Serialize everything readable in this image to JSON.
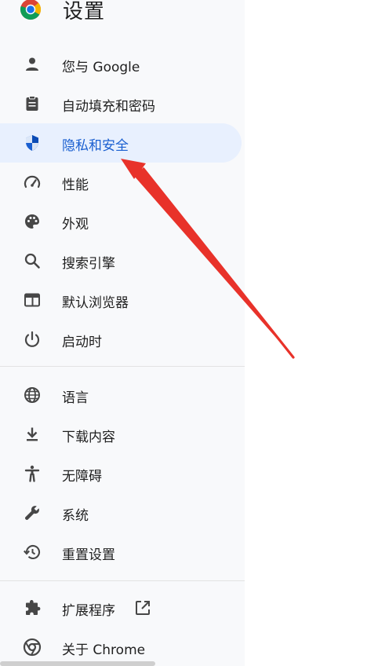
{
  "header": {
    "title": "设置"
  },
  "nav": {
    "items": [
      {
        "label": "您与 Google",
        "icon": "person-icon"
      },
      {
        "label": "自动填充和密码",
        "icon": "clipboard-icon"
      },
      {
        "label": "隐私和安全",
        "icon": "shield-icon",
        "active": true
      },
      {
        "label": "性能",
        "icon": "speedometer-icon"
      },
      {
        "label": "外观",
        "icon": "palette-icon"
      },
      {
        "label": "搜索引擎",
        "icon": "search-icon"
      },
      {
        "label": "默认浏览器",
        "icon": "browser-window-icon"
      },
      {
        "label": "启动时",
        "icon": "power-icon"
      },
      {
        "label": "语言",
        "icon": "globe-icon"
      },
      {
        "label": "下载内容",
        "icon": "download-icon"
      },
      {
        "label": "无障碍",
        "icon": "accessibility-icon"
      },
      {
        "label": "系统",
        "icon": "wrench-icon"
      },
      {
        "label": "重置设置",
        "icon": "history-icon"
      },
      {
        "label": "扩展程序",
        "icon": "puzzle-icon"
      },
      {
        "label": "关于 Chrome",
        "icon": "chrome-icon"
      }
    ]
  },
  "colors": {
    "accent": "#1a5fd0",
    "active_bg": "#e8f0fe",
    "sidebar_bg": "#f8f9fb",
    "icon": "#474747",
    "annotation_arrow": "#e8322a"
  }
}
